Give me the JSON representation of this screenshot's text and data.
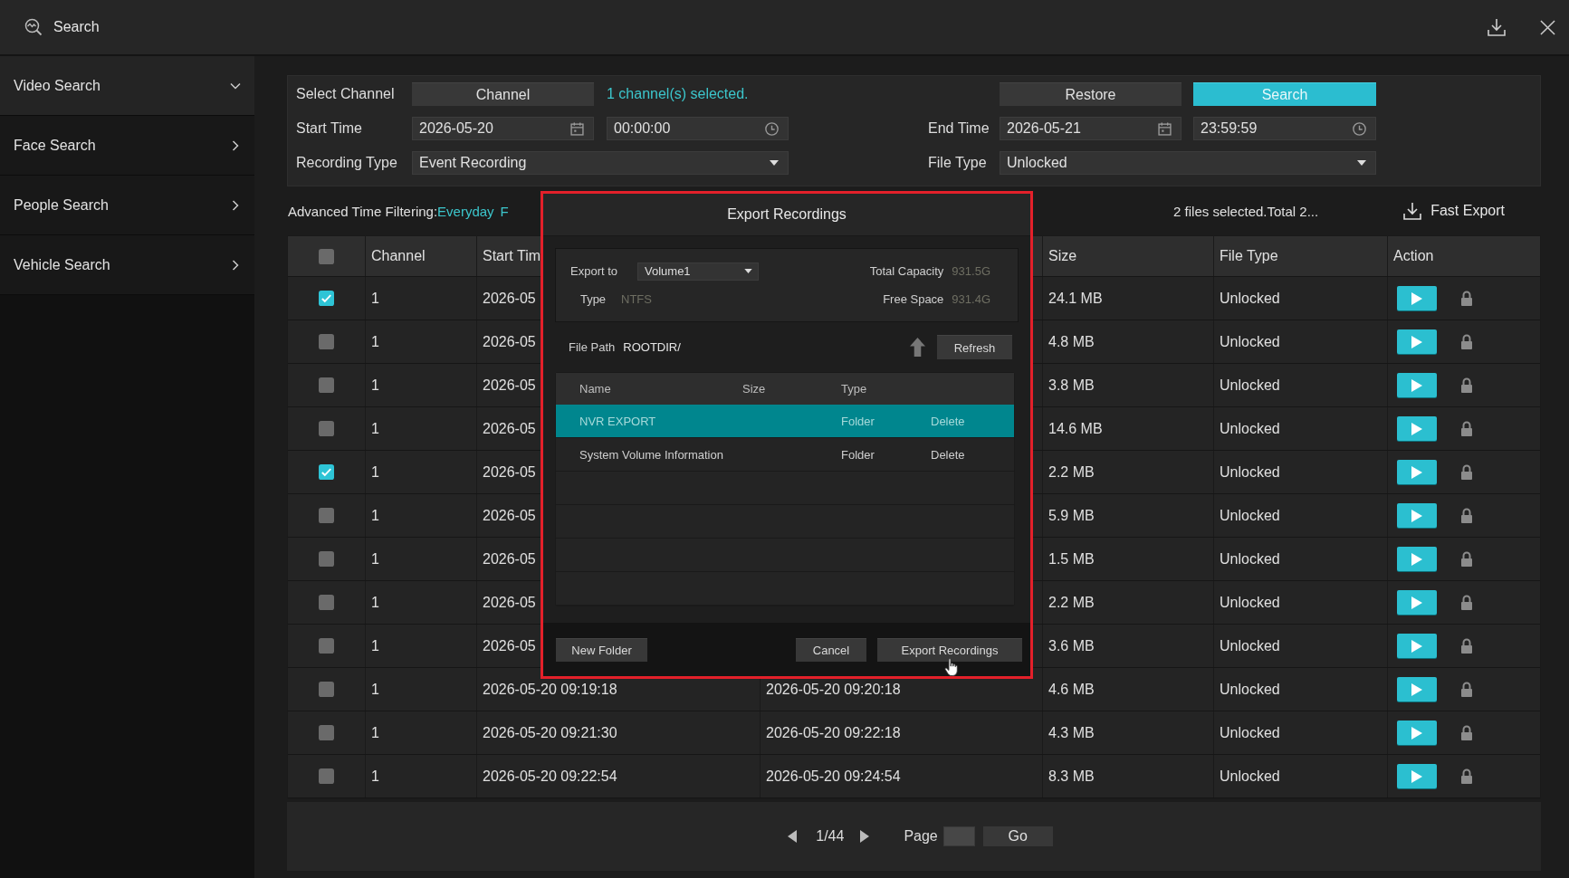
{
  "header": {
    "title": "Search"
  },
  "sidebar": {
    "items": [
      {
        "label": "Video Search",
        "expanded": true
      },
      {
        "label": "Face Search",
        "expanded": false
      },
      {
        "label": "People Search",
        "expanded": false
      },
      {
        "label": "Vehicle Search",
        "expanded": false
      }
    ]
  },
  "filters": {
    "select_channel": {
      "label": "Select Channel",
      "button": "Channel",
      "status": "1 channel(s) selected."
    },
    "restore_button": "Restore",
    "search_button": "Search",
    "start_time": {
      "label": "Start Time",
      "date": "2026-05-20",
      "time": "00:00:00"
    },
    "end_time": {
      "label": "End Time",
      "date": "2026-05-21",
      "time": "23:59:59"
    },
    "recording_type": {
      "label": "Recording Type",
      "value": "Event Recording"
    },
    "file_type": {
      "label": "File Type",
      "value": "Unlocked"
    }
  },
  "advanced_filter": {
    "label": "Advanced Time Filtering:",
    "values": [
      "Everyday",
      "F"
    ]
  },
  "selection_summary": "2 files selected.Total 2...",
  "fast_export": "Fast Export",
  "table": {
    "select_all": {
      "checked": false
    },
    "columns": {
      "channel": "Channel",
      "start_time": "Start Tim",
      "size": "Size",
      "file_type": "File Type",
      "action": "Action"
    },
    "rows": [
      {
        "checked": true,
        "channel": "1",
        "start_time": "2026-05",
        "size": "24.1 MB",
        "file_type": "Unlocked"
      },
      {
        "checked": false,
        "channel": "1",
        "start_time": "2026-05",
        "size": "4.8 MB",
        "file_type": "Unlocked"
      },
      {
        "checked": false,
        "channel": "1",
        "start_time": "2026-05",
        "size": "3.8 MB",
        "file_type": "Unlocked"
      },
      {
        "checked": false,
        "channel": "1",
        "start_time": "2026-05",
        "size": "14.6 MB",
        "file_type": "Unlocked"
      },
      {
        "checked": true,
        "channel": "1",
        "start_time": "2026-05",
        "size": "2.2 MB",
        "file_type": "Unlocked"
      },
      {
        "checked": false,
        "channel": "1",
        "start_time": "2026-05",
        "size": "5.9 MB",
        "file_type": "Unlocked"
      },
      {
        "checked": false,
        "channel": "1",
        "start_time": "2026-05",
        "size": "1.5 MB",
        "file_type": "Unlocked"
      },
      {
        "checked": false,
        "channel": "1",
        "start_time": "2026-05",
        "size": "2.2 MB",
        "file_type": "Unlocked"
      },
      {
        "checked": false,
        "channel": "1",
        "start_time": "2026-05",
        "size": "3.6 MB",
        "file_type": "Unlocked"
      },
      {
        "checked": false,
        "channel": "1",
        "start_time": "2026-05-20 09:19:18",
        "end_time": "2026-05-20 09:20:18",
        "size": "4.6 MB",
        "file_type": "Unlocked"
      },
      {
        "checked": false,
        "channel": "1",
        "start_time": "2026-05-20 09:21:30",
        "end_time": "2026-05-20 09:22:18",
        "size": "4.3 MB",
        "file_type": "Unlocked"
      },
      {
        "checked": false,
        "channel": "1",
        "start_time": "2026-05-20 09:22:54",
        "end_time": "2026-05-20 09:24:54",
        "size": "8.3 MB",
        "file_type": "Unlocked"
      }
    ]
  },
  "pagination": {
    "page": "1/44",
    "page_label": "Page",
    "go_button": "Go"
  },
  "dialog": {
    "title": "Export Recordings",
    "highlighted": true,
    "export_to": {
      "label": "Export to",
      "value": "Volume1"
    },
    "type": {
      "label": "Type",
      "value": "NTFS"
    },
    "total_capacity": {
      "label": "Total Capacity",
      "value": "931.5G"
    },
    "free_space": {
      "label": "Free Space",
      "value": "931.4G"
    },
    "file_path": {
      "label": "File Path",
      "value": "ROOTDIR/"
    },
    "refresh_button": "Refresh",
    "file_list": {
      "columns": [
        "Name",
        "Size",
        "Type"
      ],
      "rows": [
        {
          "name": "NVR EXPORT",
          "type": "Folder",
          "action": "Delete",
          "selected": true
        },
        {
          "name": "System Volume Information",
          "type": "Folder",
          "action": "Delete",
          "selected": false
        }
      ]
    },
    "new_folder_button": "New Folder",
    "cancel_button": "Cancel",
    "export_button": "Export Recordings"
  }
}
